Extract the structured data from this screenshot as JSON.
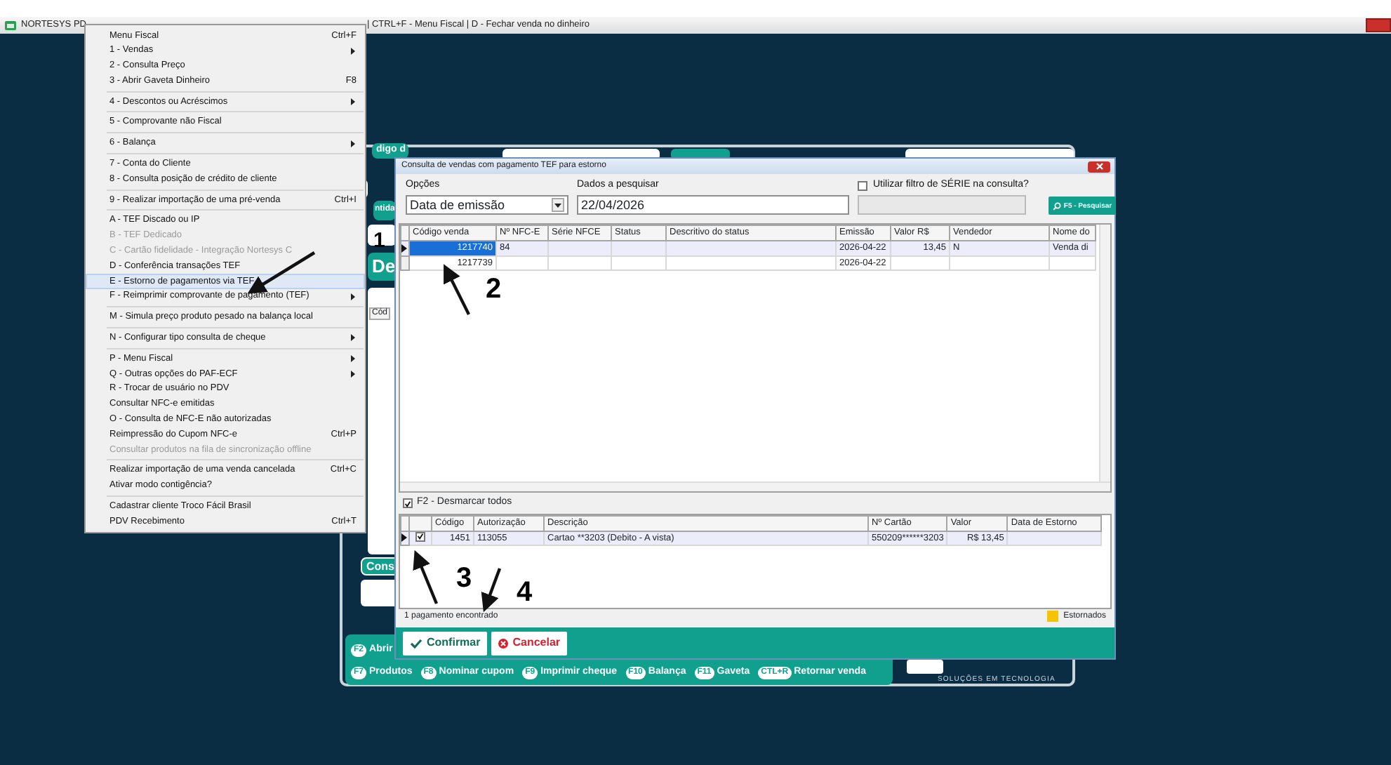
{
  "titlebar": {
    "title_left": "NORTESYS PD",
    "title_right": "| CTRL+F - Menu Fiscal | D - Fechar venda no dinheiro"
  },
  "background": {
    "code_label": "digo d",
    "qty_label": "ntida",
    "desc_label": "De",
    "column_header": "Cód",
    "consult_button": "Cons",
    "shortcuts_top": [
      {
        "key": "F2",
        "label": "Abrir"
      }
    ],
    "shortcuts": [
      {
        "key": "F7",
        "label": "Produtos"
      },
      {
        "key": "F8",
        "label": "Nominar cupom"
      },
      {
        "key": "F9",
        "label": "Imprimir cheque"
      },
      {
        "key": "F10",
        "label": "Balança"
      },
      {
        "key": "F11",
        "label": "Gaveta"
      },
      {
        "key": "CTL+R",
        "label": "Retornar venda"
      }
    ],
    "tagline": "SOLUÇÕES EM TECNOLOGIA"
  },
  "menu": {
    "groups": [
      [
        {
          "label": "Menu Fiscal",
          "shortcut": "Ctrl+F",
          "submenu": false,
          "disabled": false,
          "selected": false
        },
        {
          "label": "1 - Vendas",
          "submenu": true,
          "disabled": false,
          "selected": false
        },
        {
          "label": "2 - Consulta Preço",
          "submenu": false,
          "disabled": false,
          "selected": false
        },
        {
          "label": "3 - Abrir Gaveta Dinheiro",
          "shortcut": "F8",
          "submenu": false,
          "disabled": false,
          "selected": false
        }
      ],
      [
        {
          "label": "4 - Descontos ou Acréscimos",
          "submenu": true,
          "disabled": false,
          "selected": false
        }
      ],
      [
        {
          "label": "5 - Comprovante não Fiscal",
          "submenu": false,
          "disabled": false,
          "selected": false
        }
      ],
      [
        {
          "label": "6 - Balança",
          "submenu": true,
          "disabled": false,
          "selected": false
        }
      ],
      [
        {
          "label": "7 - Conta do Cliente",
          "submenu": false,
          "disabled": false,
          "selected": false
        },
        {
          "label": "8 - Consulta posição de crédito de cliente",
          "submenu": false,
          "disabled": false,
          "selected": false
        }
      ],
      [
        {
          "label": "9 - Realizar importação de uma pré-venda",
          "shortcut": "Ctrl+I",
          "submenu": false,
          "disabled": false,
          "selected": false
        }
      ],
      [
        {
          "label": "A - TEF Discado ou IP",
          "submenu": false,
          "disabled": false,
          "selected": false
        },
        {
          "label": "B - TEF Dedicado",
          "submenu": false,
          "disabled": true,
          "selected": false
        },
        {
          "label": "C - Cartão fidelidade - Integração Nortesys C",
          "submenu": false,
          "disabled": true,
          "selected": false
        },
        {
          "label": "D - Conferência transações TEF",
          "submenu": false,
          "disabled": false,
          "selected": false
        },
        {
          "label": "E - Estorno de pagamentos via TEF",
          "submenu": false,
          "disabled": false,
          "selected": true
        },
        {
          "label": "F - Reimprimir comprovante de pagamento (TEF)",
          "submenu": true,
          "disabled": false,
          "selected": false
        }
      ],
      [
        {
          "label": "M - Simula preço produto pesado na balança local",
          "submenu": false,
          "disabled": false,
          "selected": false
        }
      ],
      [
        {
          "label": "N - Configurar tipo consulta de cheque",
          "submenu": true,
          "disabled": false,
          "selected": false
        }
      ],
      [
        {
          "label": "P - Menu Fiscal",
          "submenu": true,
          "disabled": false,
          "selected": false
        },
        {
          "label": "Q - Outras opções do PAF-ECF",
          "submenu": true,
          "disabled": false,
          "selected": false
        },
        {
          "label": "R - Trocar de usuário no PDV",
          "submenu": false,
          "disabled": false,
          "selected": false
        },
        {
          "label": "Consultar NFC-e emitidas",
          "submenu": false,
          "disabled": false,
          "selected": false
        },
        {
          "label": "O - Consulta de NFC-E não autorizadas",
          "submenu": false,
          "disabled": false,
          "selected": false
        },
        {
          "label": "Reimpressão do Cupom NFC-e",
          "shortcut": "Ctrl+P",
          "submenu": false,
          "disabled": false,
          "selected": false
        },
        {
          "label": "Consultar produtos na fila de sincronização offline",
          "submenu": false,
          "disabled": true,
          "selected": false
        }
      ],
      [
        {
          "label": "Realizar importação de uma venda cancelada",
          "shortcut": "Ctrl+C",
          "submenu": false,
          "disabled": false,
          "selected": false
        },
        {
          "label": "Ativar modo contigência?",
          "submenu": false,
          "disabled": false,
          "selected": false
        }
      ],
      [
        {
          "label": "Cadastrar cliente Troco Fácil Brasil",
          "submenu": false,
          "disabled": false,
          "selected": false
        },
        {
          "label": "PDV Recebimento",
          "shortcut": "Ctrl+T",
          "submenu": false,
          "disabled": false,
          "selected": false
        }
      ]
    ]
  },
  "dialog": {
    "title": "Consulta de vendas com pagamento TEF para estorno",
    "options_label": "Opções",
    "options_value": "Data de emissão",
    "search_label": "Dados a pesquisar",
    "search_value": "22/04/2026",
    "series_filter": {
      "label": "Utilizar filtro de SÉRIE na consulta?",
      "checked": false
    },
    "search_button": "F5 - Pesquisar",
    "sales": {
      "columns": [
        "Código venda",
        "Nº NFC-E",
        "Série NFCE",
        "Status",
        "Descritivo do status",
        "Emissão",
        "Valor R$",
        "Vendedor",
        "Nome do"
      ],
      "rows": [
        {
          "selected": true,
          "cells": [
            "1217740",
            "84",
            "",
            "",
            "",
            "2026-04-22",
            "13,45",
            "N",
            "Venda di"
          ]
        },
        {
          "selected": false,
          "cells": [
            "1217739",
            "",
            "",
            "",
            "",
            "2026-04-22",
            "",
            "",
            ""
          ]
        }
      ]
    },
    "toggle_all": {
      "label": "F2 - Desmarcar todos",
      "checked": true
    },
    "payments": {
      "columns": [
        "Código",
        "Autorização",
        "Descrição",
        "Nº Cartão",
        "Valor",
        "Data de Estorno"
      ],
      "rows": [
        {
          "selected": true,
          "checked": true,
          "cells": [
            "1451",
            "113055",
            "Cartao **3203 (Debito - A vista)",
            "550209******3203",
            "R$ 13,45",
            ""
          ]
        }
      ]
    },
    "status": "1 pagamento encontrado",
    "legend": {
      "label": "Estornados",
      "color": "#f5c400"
    },
    "buttons": [
      {
        "kind": "confirm",
        "label": "Confirmar"
      },
      {
        "kind": "cancel",
        "label": "Cancelar"
      }
    ]
  },
  "annotations": [
    {
      "label": "1"
    },
    {
      "label": "2"
    },
    {
      "label": "3"
    },
    {
      "label": "4"
    }
  ]
}
